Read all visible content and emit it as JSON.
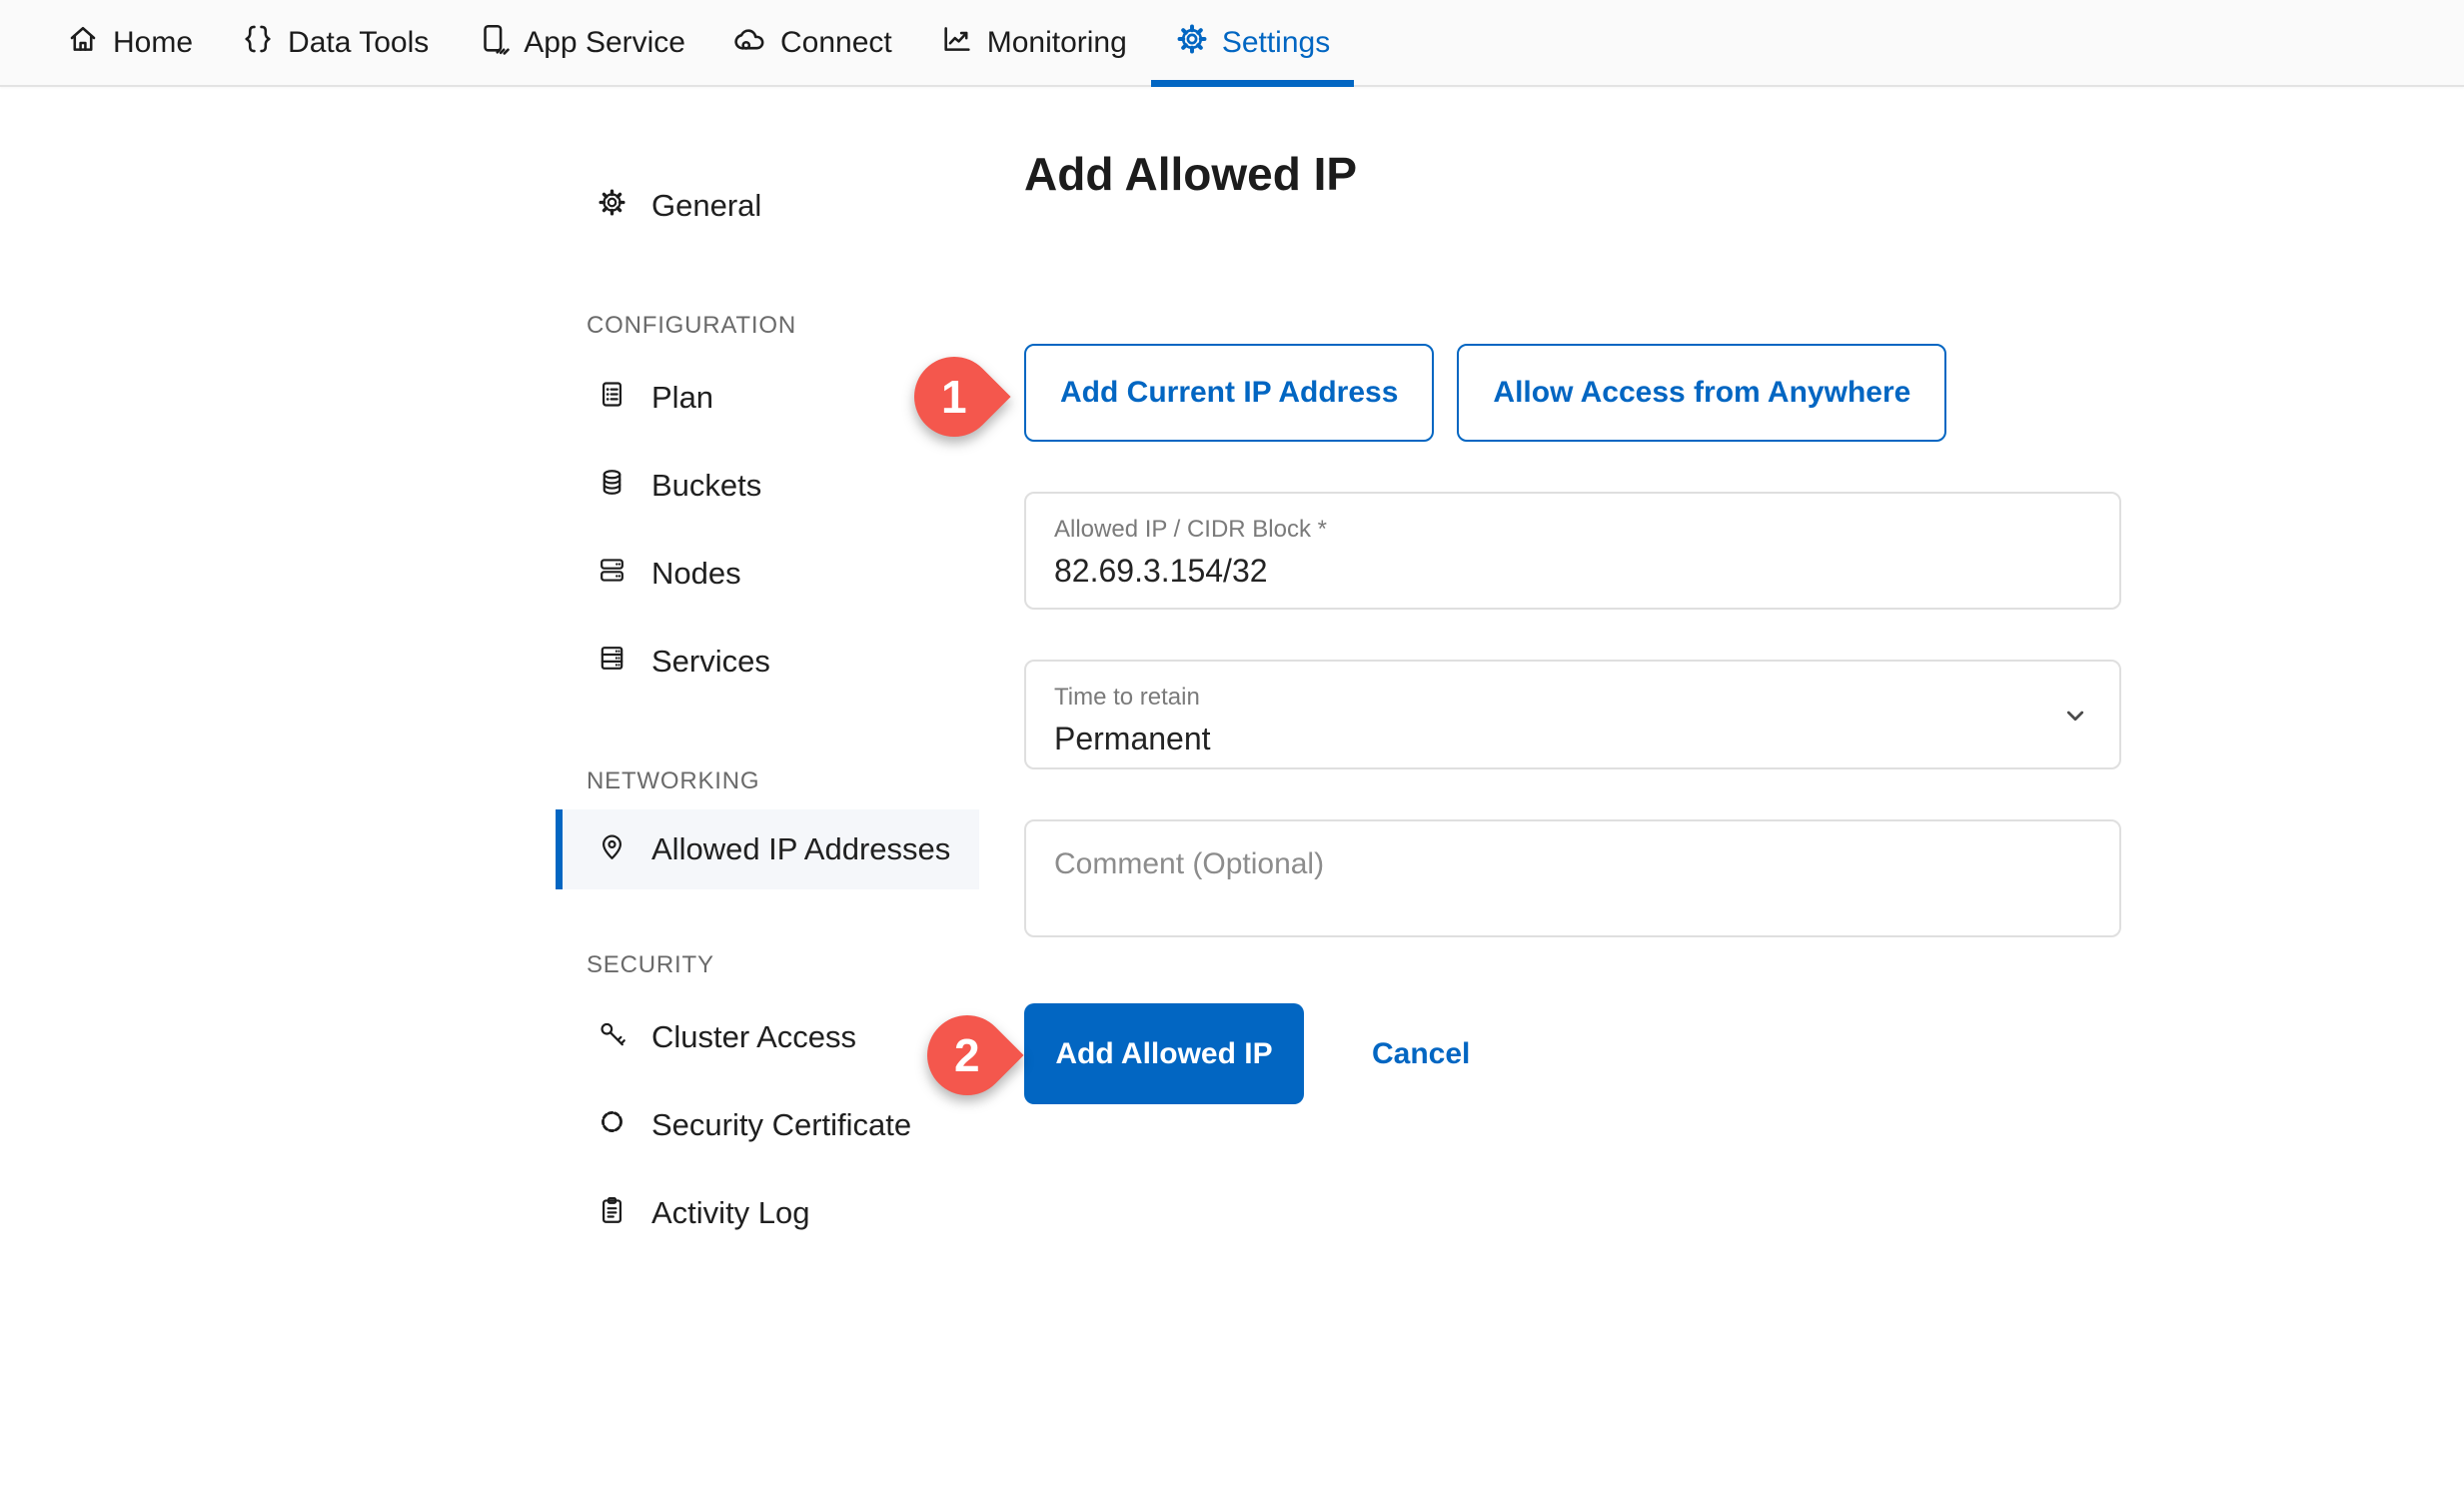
{
  "nav": {
    "items": [
      {
        "label": "Home",
        "icon": "home-icon",
        "active": false
      },
      {
        "label": "Data Tools",
        "icon": "braces-icon",
        "active": false
      },
      {
        "label": "App Service",
        "icon": "app-service-icon",
        "active": false
      },
      {
        "label": "Connect",
        "icon": "cloud-icon",
        "active": false
      },
      {
        "label": "Monitoring",
        "icon": "chart-icon",
        "active": false
      },
      {
        "label": "Settings",
        "icon": "gear-icon",
        "active": true
      }
    ]
  },
  "sidebar": {
    "top_items": [
      {
        "label": "General",
        "icon": "gear-icon"
      }
    ],
    "sections": [
      {
        "title": "CONFIGURATION",
        "items": [
          {
            "label": "Plan",
            "icon": "plan-icon",
            "active": false
          },
          {
            "label": "Buckets",
            "icon": "database-icon",
            "active": false
          },
          {
            "label": "Nodes",
            "icon": "nodes-icon",
            "active": false
          },
          {
            "label": "Services",
            "icon": "services-icon",
            "active": false
          }
        ]
      },
      {
        "title": "NETWORKING",
        "items": [
          {
            "label": "Allowed IP Addresses",
            "icon": "location-pin-icon",
            "active": true
          }
        ]
      },
      {
        "title": "SECURITY",
        "items": [
          {
            "label": "Cluster Access",
            "icon": "key-icon",
            "active": false
          },
          {
            "label": "Security Certificate",
            "icon": "certificate-icon",
            "active": false
          },
          {
            "label": "Activity Log",
            "icon": "activity-log-icon",
            "active": false
          }
        ]
      }
    ]
  },
  "main": {
    "title": "Add Allowed IP",
    "quick_actions": [
      {
        "label": "Add Current IP Address"
      },
      {
        "label": "Allow Access from Anywhere"
      }
    ],
    "form": {
      "allowed_ip": {
        "label": "Allowed IP / CIDR Block *",
        "value": "82.69.3.154/32"
      },
      "time_to_retain": {
        "label": "Time to retain",
        "value": "Permanent"
      },
      "comment": {
        "placeholder": "Comment (Optional)"
      }
    },
    "actions": {
      "submit_label": "Add Allowed IP",
      "cancel_label": "Cancel"
    }
  },
  "annotations": {
    "step1": "1",
    "step2": "2"
  },
  "colors": {
    "accent_blue": "#0266C2",
    "marker_red": "#F4574D",
    "active_row_bg": "#F5F7FA"
  }
}
